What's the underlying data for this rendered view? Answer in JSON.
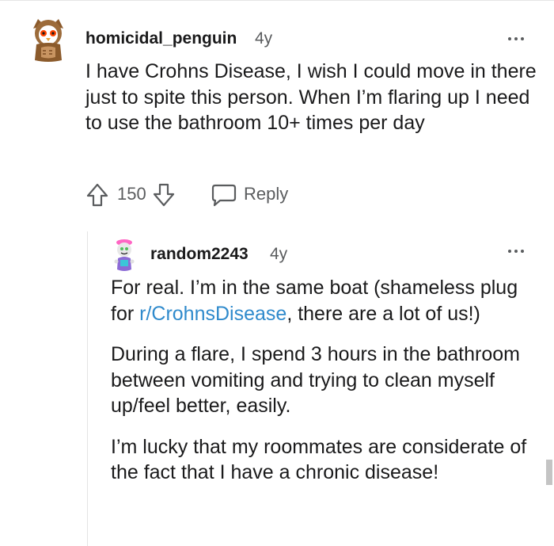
{
  "comments": [
    {
      "username": "homicidal_penguin",
      "age": "4y",
      "body": [
        "I have Crohns Disease, I wish I could move in there just to spite this person. When I’m flaring up I need to use the bathroom 10+ times per day"
      ],
      "score": "150",
      "reply_label": "Reply"
    },
    {
      "username": "random2243",
      "age": "4y",
      "p1_before_link": "For real. I’m in the same boat (shameless plug for ",
      "p1_link": "r/CrohnsDisease",
      "p1_after_link": ", there are a lot of us!)",
      "p2": "During a flare, I spend 3 hours in the bathroom between vomiting and trying to clean myself up/feel better, easily.",
      "p3": "I’m lucky that my roommates are considerate of the fact that I have a chronic disease!"
    }
  ],
  "colors": {
    "text": "#1a1a1b",
    "meta": "#5a5c5e",
    "link": "#2f8acc",
    "thread_line": "#e3e3e3"
  },
  "icons": {
    "upvote": "upvote-arrow-icon",
    "downvote": "downvote-arrow-icon",
    "reply": "speech-bubble-icon",
    "more": "more-options-icon"
  }
}
